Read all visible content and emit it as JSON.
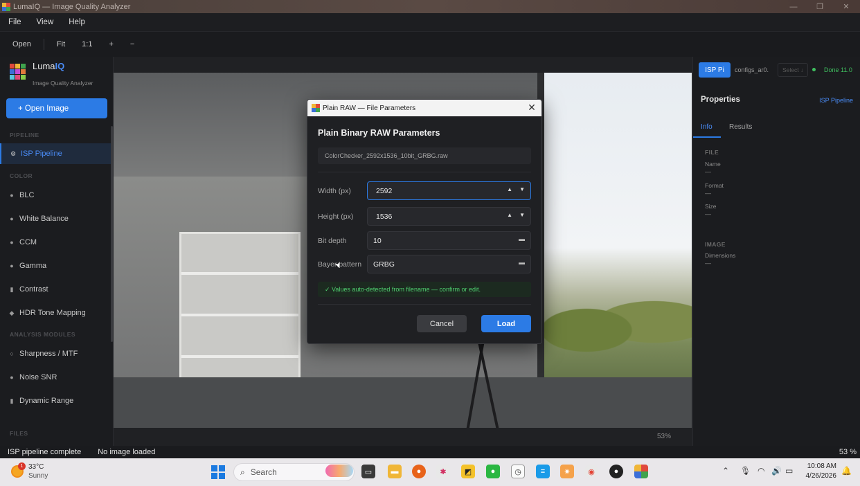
{
  "window": {
    "title": "LumaIQ — Image Quality Analyzer",
    "controls": [
      "—",
      "❐",
      "✕"
    ]
  },
  "menu": [
    "File",
    "View",
    "Help"
  ],
  "toolbar": {
    "open": "Open",
    "fit": "Fit",
    "one_to_one": "1:1",
    "zoom_in": "+",
    "zoom_out": "−"
  },
  "sidebar": {
    "brand_name": "Luma",
    "brand_accent": "IQ",
    "brand_subtitle": "Image Quality Analyzer",
    "open_button": "+ Open Image",
    "sections": {
      "pipeline": "PIPELINE",
      "color": "COLOR",
      "analysis": "ANALYSIS MODULES",
      "files": "FILES"
    },
    "items": {
      "isp": "ISP Pipeline",
      "blc": "BLC",
      "wb": "White Balance",
      "ccm": "CCM",
      "gamma": "Gamma",
      "contrast": "Contrast",
      "hdr": "HDR Tone Mapping",
      "sharpness": "Sharpness / MTF",
      "noise": "Noise  SNR",
      "dr": "Dynamic Range"
    },
    "icons": {
      "isp": "gear-icon",
      "blc": "dot-icon",
      "hdr": "diamond-icon",
      "sharpness": "circle-icon"
    }
  },
  "canvas": {
    "zoom": "53%"
  },
  "right_panel": {
    "isp_button": "ISP Pi",
    "config": "configs_ar0.",
    "select_placeholder": "Select ↓",
    "status": "Done  11.0",
    "properties": "Properties",
    "properties_link": "ISP Pipeline",
    "tabs": [
      "Info",
      "Results"
    ],
    "file_section": "FILE",
    "fields": [
      {
        "key": "Name",
        "value": "—"
      },
      {
        "key": "Format",
        "value": "—"
      },
      {
        "key": "Size",
        "value": "—"
      }
    ],
    "image_section": "IMAGE",
    "image_fields": [
      {
        "key": "Dimensions",
        "value": "—"
      }
    ]
  },
  "dialog": {
    "title": "Plain RAW — File Parameters",
    "heading": "Plain Binary RAW Parameters",
    "filename": "ColorChecker_2592x1536_10bit_GRBG.raw",
    "width_label": "Width (px)",
    "width_value": "2592",
    "height_label": "Height (px)",
    "height_value": "1536",
    "bitdepth_label": "Bit depth",
    "bitdepth_value": "10",
    "bayer_label": "Bayer pattern",
    "bayer_value": "GRBG",
    "notice": "✓  Values auto-detected from filename — confirm or edit.",
    "cancel": "Cancel",
    "load": "Load"
  },
  "statusbar": {
    "left": "ISP pipeline complete",
    "middle": "No image loaded",
    "right": "53 %"
  },
  "taskbar": {
    "weather_temp": "33°C",
    "weather_desc": "Sunny",
    "weather_badge": "1",
    "search": "Search",
    "time": "10:08 AM",
    "date": "4/26/2026"
  },
  "colors": {
    "accent": "#2c7be5",
    "success": "#3fbf5f",
    "sidebar_bg": "#1b1c1f"
  }
}
